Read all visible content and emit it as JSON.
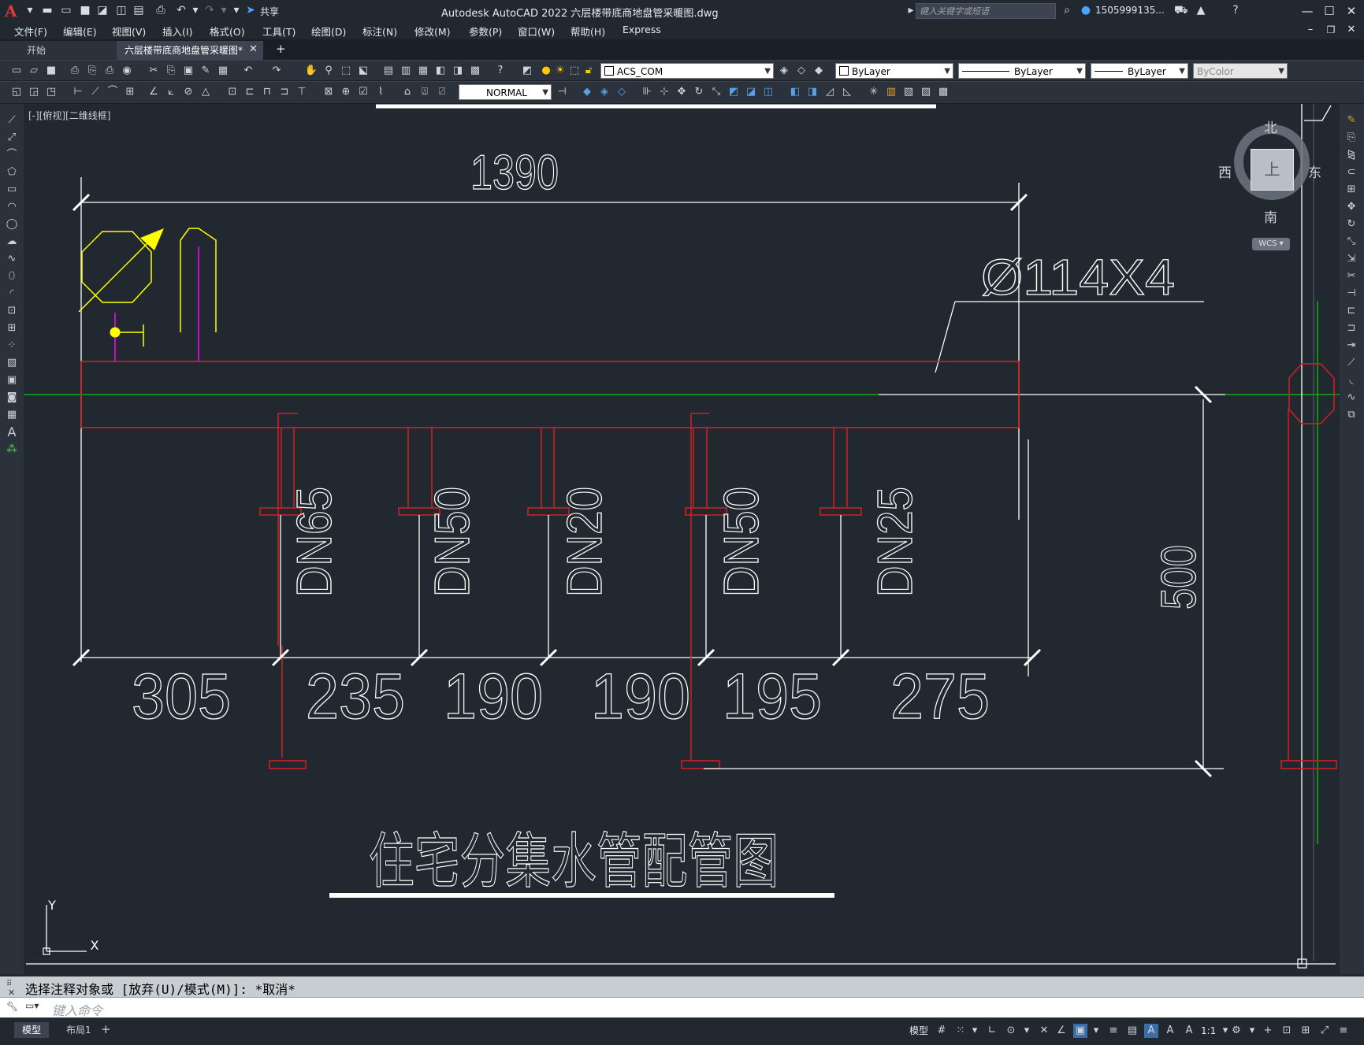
{
  "app": {
    "title": "Autodesk AutoCAD 2022    六层楼带底商地盘管采暖图.dwg",
    "logo": "A",
    "search_placeholder": "键入关键字或短语",
    "user": "1505999135...",
    "share_label": "共享"
  },
  "menu": [
    "文件(F)",
    "编辑(E)",
    "视图(V)",
    "插入(I)",
    "格式(O)",
    "工具(T)",
    "绘图(D)",
    "标注(N)",
    "修改(M)",
    "参数(P)",
    "窗口(W)",
    "帮助(H)",
    "Express"
  ],
  "tabs": {
    "start": "开始",
    "drawing": "六层楼带底商地盘管采暖图*"
  },
  "toolbar": {
    "layer": "ACS_COM",
    "color": "ByLayer",
    "linetype": "ByLayer",
    "lineweight": "ByLayer",
    "plotstyle": "ByColor",
    "dimstyle": "NORMAL"
  },
  "viewport_label": "[-][俯视][二维线框]",
  "viewcube": {
    "north": "北",
    "south": "南",
    "east": "东",
    "west": "西",
    "face": "上",
    "wcs": "WCS"
  },
  "drawing": {
    "overall_width": "1390",
    "pipe_spec": "Ø114X4",
    "height_dim": "500",
    "segments": [
      "305",
      "235",
      "190",
      "190",
      "195",
      "275"
    ],
    "pipes": [
      "DN65",
      "DN50",
      "DN20",
      "DN50",
      "DN25"
    ],
    "title": "住宅分集水管配管图",
    "ucs_x": "X",
    "ucs_y": "Y"
  },
  "command": {
    "history": "选择注释对象或 [放弃(U)/模式(M)]: *取消*",
    "placeholder": "键入命令"
  },
  "layout_tabs": [
    "模型",
    "布局1"
  ],
  "status": {
    "model": "模型",
    "scale": "1:1"
  },
  "colors": {
    "background": "#212830",
    "pipe_red": "#d42020",
    "dimension_white": "#ffffff",
    "leader_yellow": "#ffff00",
    "axis_green": "#10c010"
  }
}
